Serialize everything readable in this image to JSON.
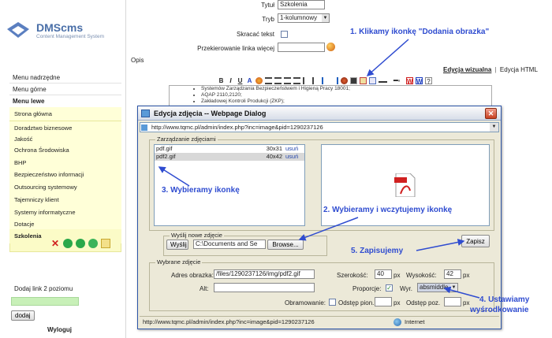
{
  "logo": {
    "name": "DMScms",
    "tagline": "Content Management System"
  },
  "sidebar": {
    "top_items": [
      "Menu nadrzędne",
      "Menu górne"
    ],
    "section": "Menu lewe",
    "items": [
      {
        "label": "Strona główna"
      },
      {
        "label": "Doradztwo biznesowe"
      },
      {
        "label": "Jakość"
      },
      {
        "label": "Ochrona Środowiska"
      },
      {
        "label": "BHP"
      },
      {
        "label": "Bezpieczeństwo informacji"
      },
      {
        "label": "Outsourcing systemowy"
      },
      {
        "label": "Tajemniczy klient"
      },
      {
        "label": "Systemy informatyczne"
      },
      {
        "label": "Dotacje"
      },
      {
        "label": "Szkolenia"
      }
    ],
    "add_sub_label": "Dodaj link 2 poziomu",
    "add_button": "dodaj",
    "logout": "Wyloguj"
  },
  "form": {
    "title_label": "Tytuł",
    "title_value": "Szkolenia",
    "mode_label": "Tryb",
    "mode_value": "1-kolumnowy",
    "shorten_label": "Skracać tekst",
    "redirect_label": "Przekierowanie linka więcej",
    "desc_label": "Opis",
    "tab_visual": "Edycja wizualna",
    "tab_html": "Edycja HTML",
    "editor_lines": [
      "Systemów Zarządzania Bezpieczeństwem i Higieną Pracy 18001;",
      "AQAP 2110,2120;",
      "Zakładowej Kontroli Produkcji (ZKP);"
    ]
  },
  "toolbar_glyphs": [
    "B",
    "I",
    "U",
    "A"
  ],
  "dialog": {
    "title": "Edycja zdjęcia -- Webpage Dialog",
    "url": "http://www.tqmc.pl/admin/index.php?inc=image&pid=1290237126",
    "manage_legend": "Zarządzanie zdjęciami",
    "files": [
      {
        "name": "pdf.gif",
        "dims": "30x31",
        "action": "usuń"
      },
      {
        "name": "pdf2.gif",
        "dims": "40x42",
        "action": "usuń"
      }
    ],
    "upload_legend": "Wyślij nowe zdjęcie",
    "send_button": "Wyślij",
    "file_path": "C:\\Documents and Se",
    "browse_button": "Browse...",
    "save_button": "Zapisz",
    "selected_legend": "Wybrane zdjęcie",
    "address_label": "Adres obrazka:",
    "address_value": "/files/1290237126/img/pdf2.gif",
    "width_label": "Szerokość:",
    "width_value": "40",
    "height_label": "Wysokość:",
    "height_value": "42",
    "unit": "px",
    "alt_label": "Alt:",
    "proportions_label": "Proporcje:",
    "align_label": "Wyr.",
    "align_value": "absmiddle",
    "border_label": "Obramowanie:",
    "vspace_label": "Odstęp pion.",
    "hspace_label": "Odstęp poz.",
    "status_url": "http://www.tqmc.pl/admin/index.php?inc=image&pid=1290237126",
    "status_zone": "Internet"
  },
  "annotations": {
    "a1": "1. Klikamy ikonkę \"Dodania obrazka\"",
    "a2": "2. Wybieramy i wczytujemy ikonkę",
    "a3": "3. Wybieramy ikonkę",
    "a4a": "4. Ustawiamy",
    "a4b": "wyśrodkowanie",
    "a5": "5. Zapisujemy"
  },
  "colors": {
    "accent": "#2f4cd0",
    "menu_bg": "#fbfbc7",
    "dialog_bg": "#ece9d8"
  }
}
